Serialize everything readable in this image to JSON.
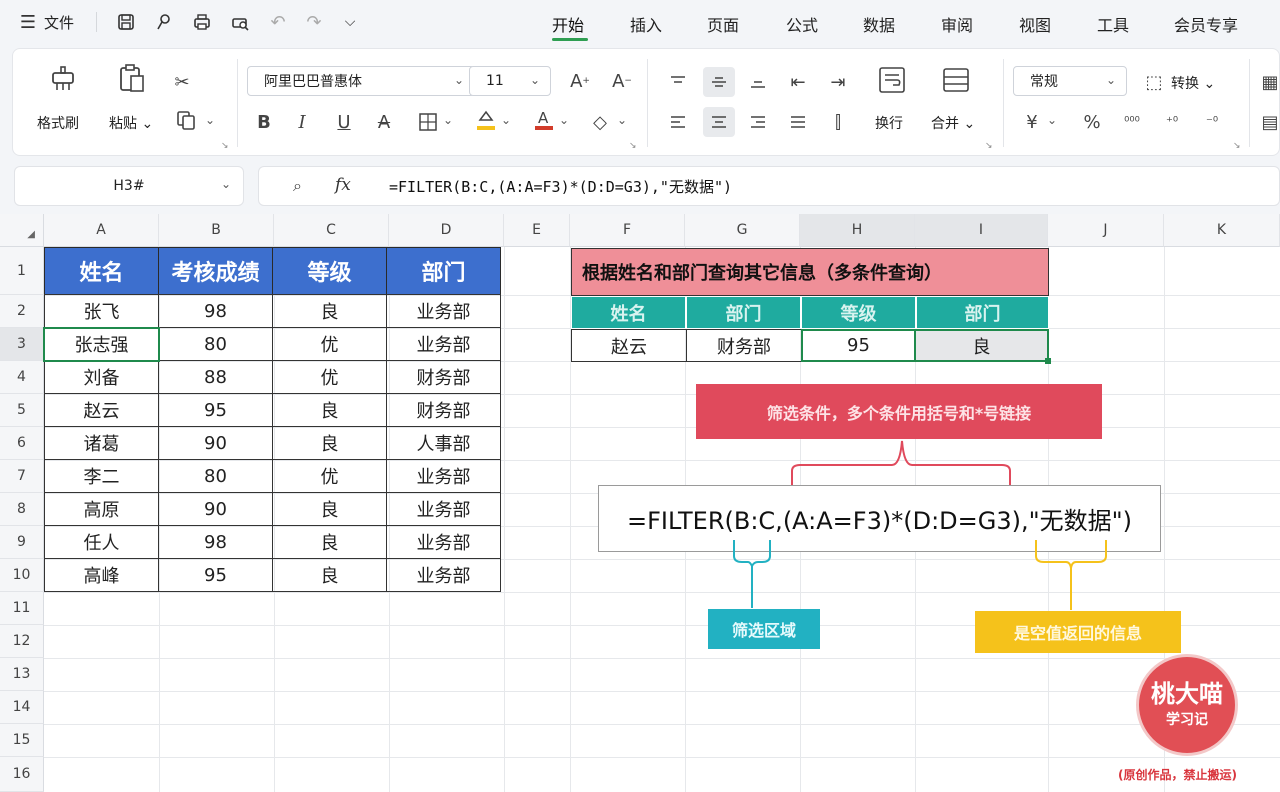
{
  "menubar": {
    "file_label": "文件",
    "tabs": [
      "开始",
      "插入",
      "页面",
      "公式",
      "数据",
      "审阅",
      "视图",
      "工具",
      "会员专享"
    ],
    "active_tab": "开始"
  },
  "ribbon": {
    "format_painter": "格式刷",
    "paste": "粘贴",
    "font_name": "阿里巴巴普惠体",
    "font_size": "11",
    "wrap": "换行",
    "merge": "合并",
    "number_format": "常规",
    "convert": "转换",
    "percent": "%"
  },
  "formula_bar": {
    "name_box": "H3#",
    "fx": "fx",
    "formula": "=FILTER(B:C,(A:A=F3)*(D:D=G3),\"无数据\")"
  },
  "sheet": {
    "columns": [
      "A",
      "B",
      "C",
      "D",
      "E",
      "F",
      "G",
      "H",
      "I",
      "J",
      "K"
    ],
    "rows": [
      "1",
      "2",
      "3",
      "4",
      "5",
      "6",
      "7",
      "8",
      "9",
      "10",
      "11",
      "12",
      "13",
      "14",
      "15",
      "16"
    ],
    "table_headers": [
      "姓名",
      "考核成绩",
      "等级",
      "部门"
    ],
    "table_rows": [
      [
        "张飞",
        "98",
        "良",
        "业务部"
      ],
      [
        "张志强",
        "80",
        "优",
        "业务部"
      ],
      [
        "刘备",
        "88",
        "优",
        "财务部"
      ],
      [
        "赵云",
        "95",
        "良",
        "财务部"
      ],
      [
        "诸葛",
        "90",
        "良",
        "人事部"
      ],
      [
        "李二",
        "80",
        "优",
        "业务部"
      ],
      [
        "高原",
        "90",
        "良",
        "业务部"
      ],
      [
        "任人",
        "98",
        "良",
        "业务部"
      ],
      [
        "高峰",
        "95",
        "良",
        "业务部"
      ]
    ],
    "query_title": "根据姓名和部门查询其它信息（多条件查询）",
    "query_headers": [
      "姓名",
      "部门",
      "等级",
      "部门"
    ],
    "query_values": [
      "赵云",
      "财务部",
      "95",
      "良"
    ]
  },
  "annotations": {
    "conditions_note": "筛选条件，多个条件用括号和*号链接",
    "formula_display": "=FILTER(B:C,(A:A=F3)*(D:D=G3),\"无数据\")",
    "range_note": "筛选区域",
    "empty_note": "是空值返回的信息"
  },
  "watermark": {
    "brand": "桃大喵",
    "sub": "学习记",
    "notice": "(原创作品，禁止搬运)"
  },
  "colors": {
    "header_blue": "#3d6fce",
    "title_pink": "#ef8f98",
    "teal": "#1fab9f",
    "callout_red": "#e04a5c",
    "callout_yellow": "#f5c21b",
    "accent_green": "#2e9e52"
  }
}
